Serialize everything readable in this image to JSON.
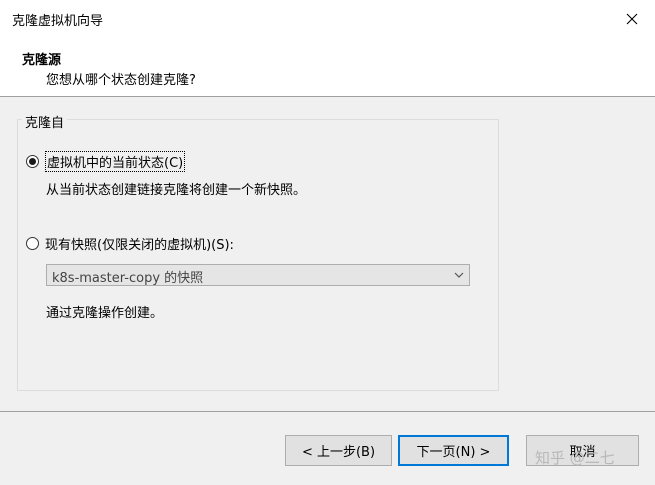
{
  "window": {
    "title": "克隆虚拟机向导",
    "close_icon": "close-icon"
  },
  "header": {
    "title": "克隆源",
    "subtitle": "您想从哪个状态创建克隆?"
  },
  "group": {
    "label": "克隆自",
    "option_current": {
      "label": "虚拟机中的当前状态(C)",
      "description": "从当前状态创建链接克隆将创建一个新快照。",
      "selected": true
    },
    "option_snapshot": {
      "label": "现有快照(仅限关闭的虚拟机)(S):",
      "selected": false,
      "select_value": "k8s-master-copy 的快照",
      "description": "通过克隆操作创建。"
    }
  },
  "footer": {
    "back_label": "< 上一步(B)",
    "next_label": "下一页(N) >",
    "cancel_label": "取消"
  },
  "watermark": "知乎 @二七",
  "colors": {
    "accent": "#0078d7",
    "content_bg": "#f0f0f0"
  }
}
